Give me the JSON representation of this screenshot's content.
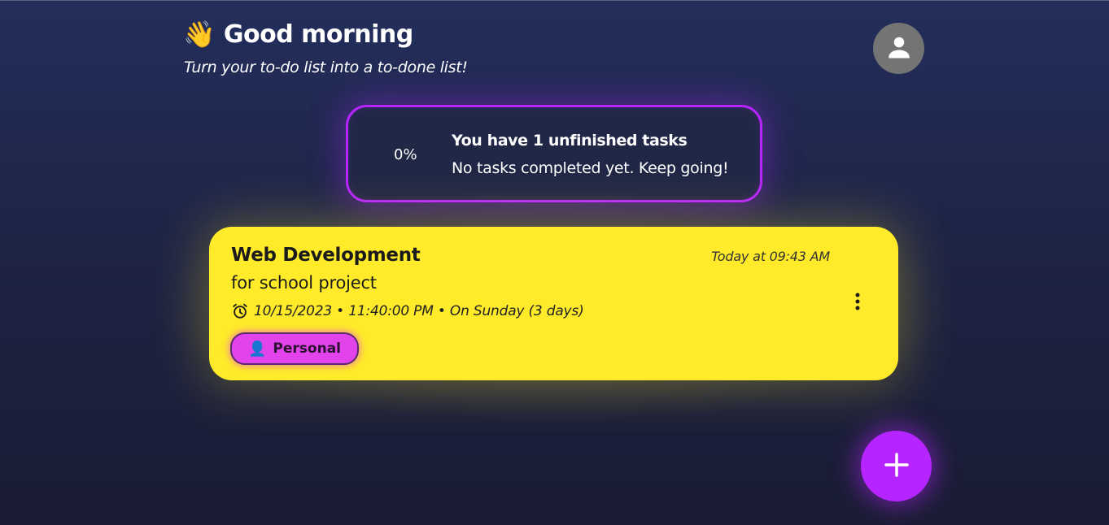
{
  "header": {
    "wave_emoji": "👋",
    "greeting": "Good morning",
    "subtitle": "Turn your to-do list into a to-done list!"
  },
  "summary": {
    "progress_percent": 0,
    "progress_label": "0%",
    "title": "You have 1 unfinished tasks",
    "message": "No tasks completed yet. Keep going!"
  },
  "tasks": [
    {
      "title": "Web Development",
      "description": "for school project",
      "created": "Today at 09:43 AM",
      "deadline": "10/15/2023 • 11:40:00 PM • On Sunday (3 days)",
      "color": "#ffeb29",
      "category": {
        "emoji": "👤",
        "label": "Personal",
        "color": "#e343ea"
      }
    }
  ],
  "colors": {
    "accent": "#b624ff",
    "task_card": "#ffeb29",
    "category_chip": "#e343ea",
    "avatar_bg": "#747474"
  },
  "icons": {
    "avatar": "user-icon",
    "deadline": "alarm-clock-icon",
    "menu": "more-vertical-icon",
    "fab": "plus-icon"
  }
}
